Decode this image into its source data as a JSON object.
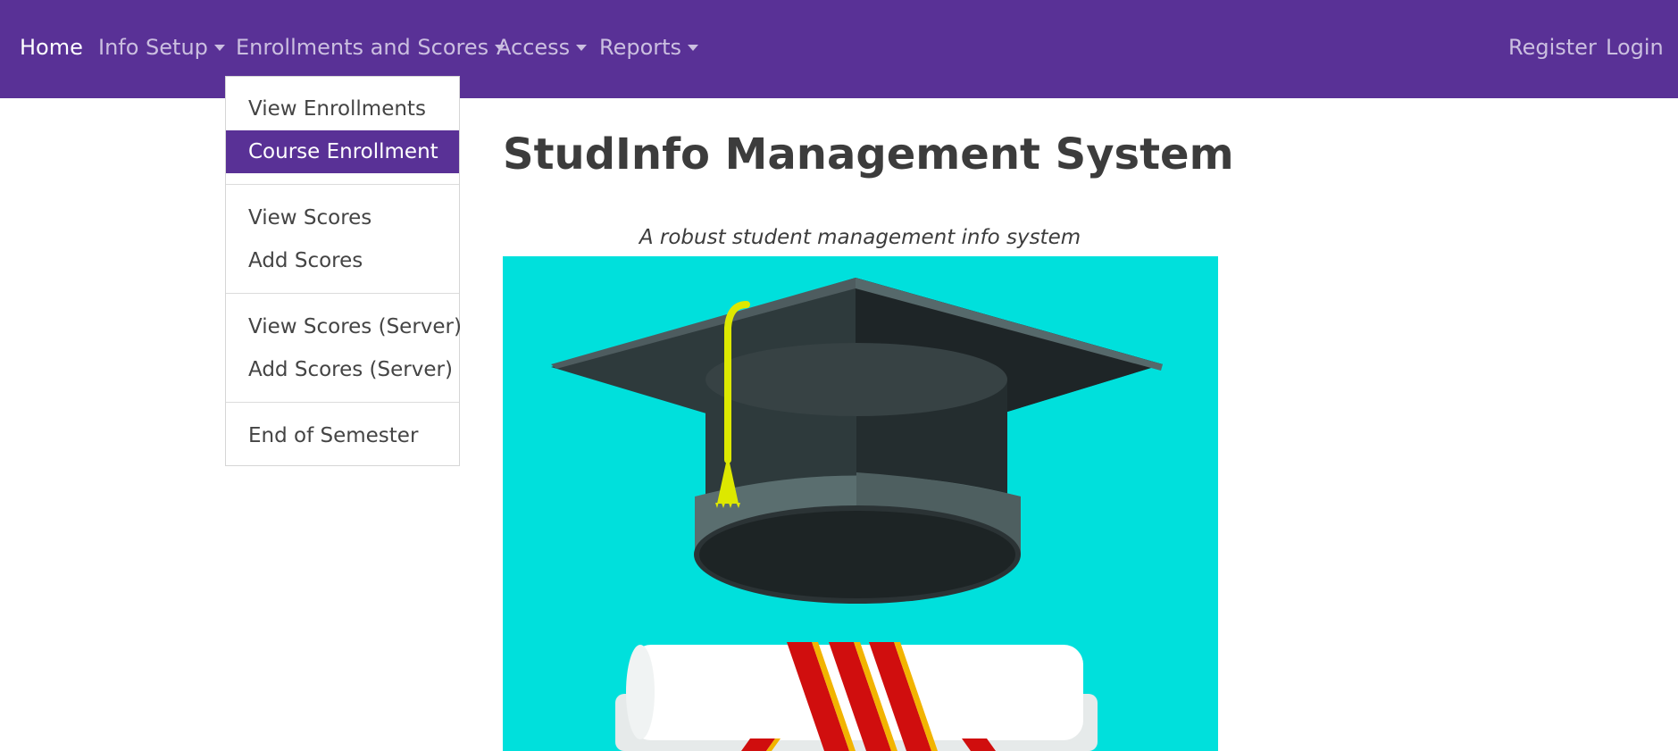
{
  "navbar": {
    "brand_color": "#593196",
    "left_items": [
      {
        "label": "Home",
        "active": true,
        "dropdown": false
      },
      {
        "label": "Info Setup",
        "dropdown": true
      },
      {
        "label": "Enrollments and Scores",
        "dropdown": true,
        "open": true
      },
      {
        "label": "Access",
        "dropdown": true
      },
      {
        "label": "Reports",
        "dropdown": true
      }
    ],
    "right_items": [
      {
        "label": "Register"
      },
      {
        "label": "Login"
      }
    ]
  },
  "dropdown": {
    "groups": [
      [
        "View Enrollments",
        "Course Enrollment"
      ],
      [
        "View Scores",
        "Add Scores"
      ],
      [
        "View Scores (Server)",
        "Add Scores (Server)"
      ],
      [
        "End of Semester"
      ]
    ],
    "items": [
      {
        "label": "View Enrollments"
      },
      {
        "label": "Course Enrollment",
        "highlighted": true
      },
      {
        "label": "View Scores"
      },
      {
        "label": "Add Scores"
      },
      {
        "label": "View Scores (Server)"
      },
      {
        "label": "Add Scores (Server)"
      },
      {
        "label": "End of Semester"
      }
    ]
  },
  "main": {
    "title": "StudInfo Management System",
    "subtitle": "A robust student management info system",
    "hero_image": {
      "icon": "graduation-cap-and-diploma-illustration",
      "background_color": "#00e0dc"
    }
  }
}
